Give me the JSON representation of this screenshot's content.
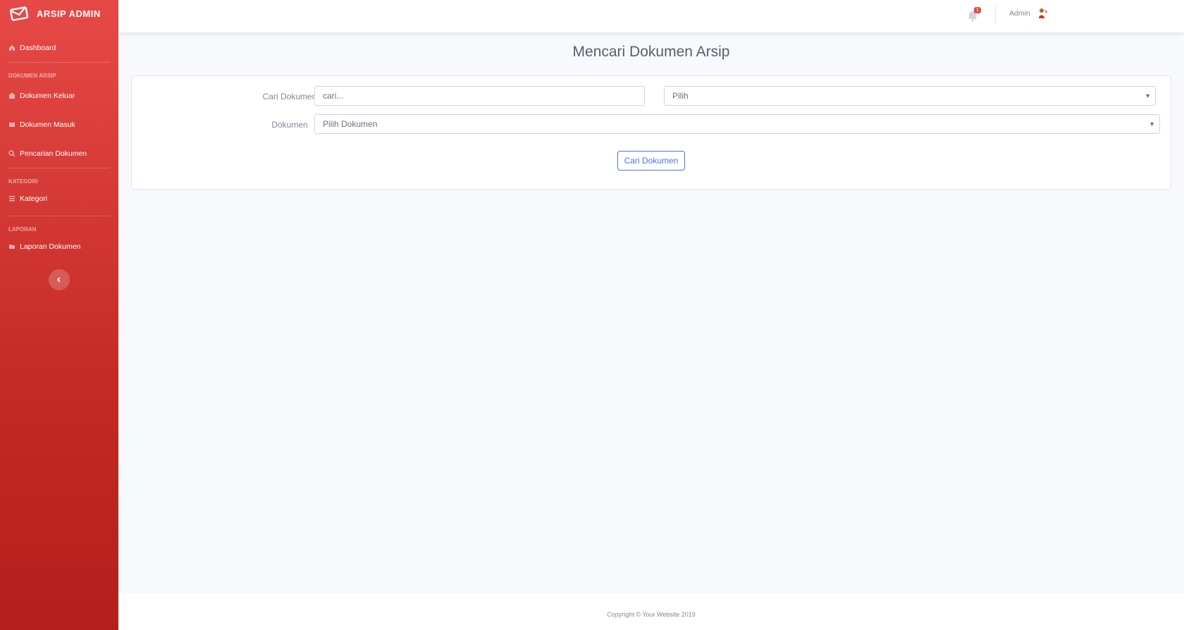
{
  "brand": {
    "name": "ARSIP ADMIN",
    "icon": "envelope-icon"
  },
  "sidebar": {
    "dashboard": {
      "label": "Dashboard",
      "icon": "home-icon"
    },
    "sections": [
      {
        "heading": "DOKUMEN ARSIP",
        "items": [
          {
            "label": "Dokumen Keluar",
            "icon": "building-icon"
          },
          {
            "label": "Dokumen Masuk",
            "icon": "inbox-icon"
          },
          {
            "label": "Pencarian Dokumen",
            "icon": "search-icon"
          }
        ]
      },
      {
        "heading": "KATEGORI",
        "items": [
          {
            "label": "Kategori",
            "icon": "list-icon"
          }
        ]
      },
      {
        "heading": "LAPORAN",
        "items": [
          {
            "label": "Laporan Dokumen",
            "icon": "folder-icon"
          }
        ]
      }
    ],
    "toggle_icon": "chevron-left-icon"
  },
  "topbar": {
    "alert_count": "1",
    "user_name": "Admin"
  },
  "main": {
    "title": "Mencari Dokumen Arsip",
    "form": {
      "search_label": "Cari Dokumen",
      "search_placeholder": "cari...",
      "filter_select_value": "Pilih",
      "document_label": "Dokumen",
      "document_select_value": "Pilih Dokumen",
      "submit_label": "Cari Dokumen"
    }
  },
  "footer": {
    "copyright": "Copyright © Your Website 2019"
  },
  "colors": {
    "sidebar_top": "#e74a46",
    "sidebar_bottom": "#b51f1b",
    "primary": "#4e73df",
    "background": "#f8f9fc"
  }
}
